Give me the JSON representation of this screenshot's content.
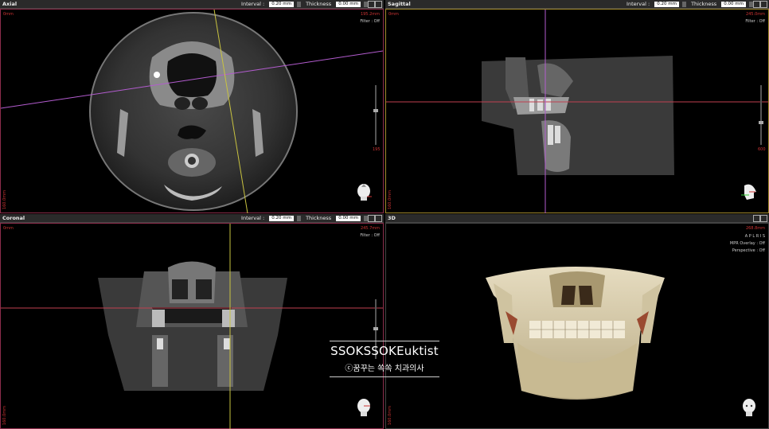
{
  "panels": {
    "axial": {
      "title": "Axial",
      "interval_label": "Interval :",
      "interval_value": "0.20 mm",
      "thickness_label": "Thickness",
      "thickness_value": "0.00 mm",
      "top_left": "0mm",
      "top_right": "195.2mm",
      "filter": "Filter : Off",
      "slider_value": "195",
      "bottom_left": "160.0mm"
    },
    "sagittal": {
      "title": "Sagittal",
      "interval_label": "Interval :",
      "interval_value": "0.20 mm",
      "thickness_label": "Thickness",
      "thickness_value": "0.00 mm",
      "top_left": "0mm",
      "top_right": "245.0mm",
      "filter": "Filter : Off",
      "slider_value": "600",
      "bottom_left": "160.0mm"
    },
    "coronal": {
      "title": "Coronal",
      "interval_label": "Interval :",
      "interval_value": "0.20 mm",
      "thickness_label": "Thickness",
      "thickness_value": "0.00 mm",
      "top_left": "0mm",
      "top_right": "245.7mm",
      "filter": "Filter : Off",
      "bottom_left": "160.0mm"
    },
    "three_d": {
      "title": "3D",
      "top_right": "268.8mm",
      "orientation": "A P L R I S",
      "mpr_overlay": "MPR Overlay : Off",
      "perspective": "Perspective : Off",
      "bottom_left": "160.0mm"
    }
  },
  "watermark": {
    "title": "SSOKSSOKEuktist",
    "subtitle": "ⓒ꿈꾸는 쏙쏙 치과의사"
  },
  "colors": {
    "frame_red": "#8c2d4b",
    "frame_yellow": "#a28a2c",
    "crosshair_purple": "#b35ccf",
    "crosshair_yellow": "#c9c340",
    "crosshair_red": "#c04050"
  }
}
